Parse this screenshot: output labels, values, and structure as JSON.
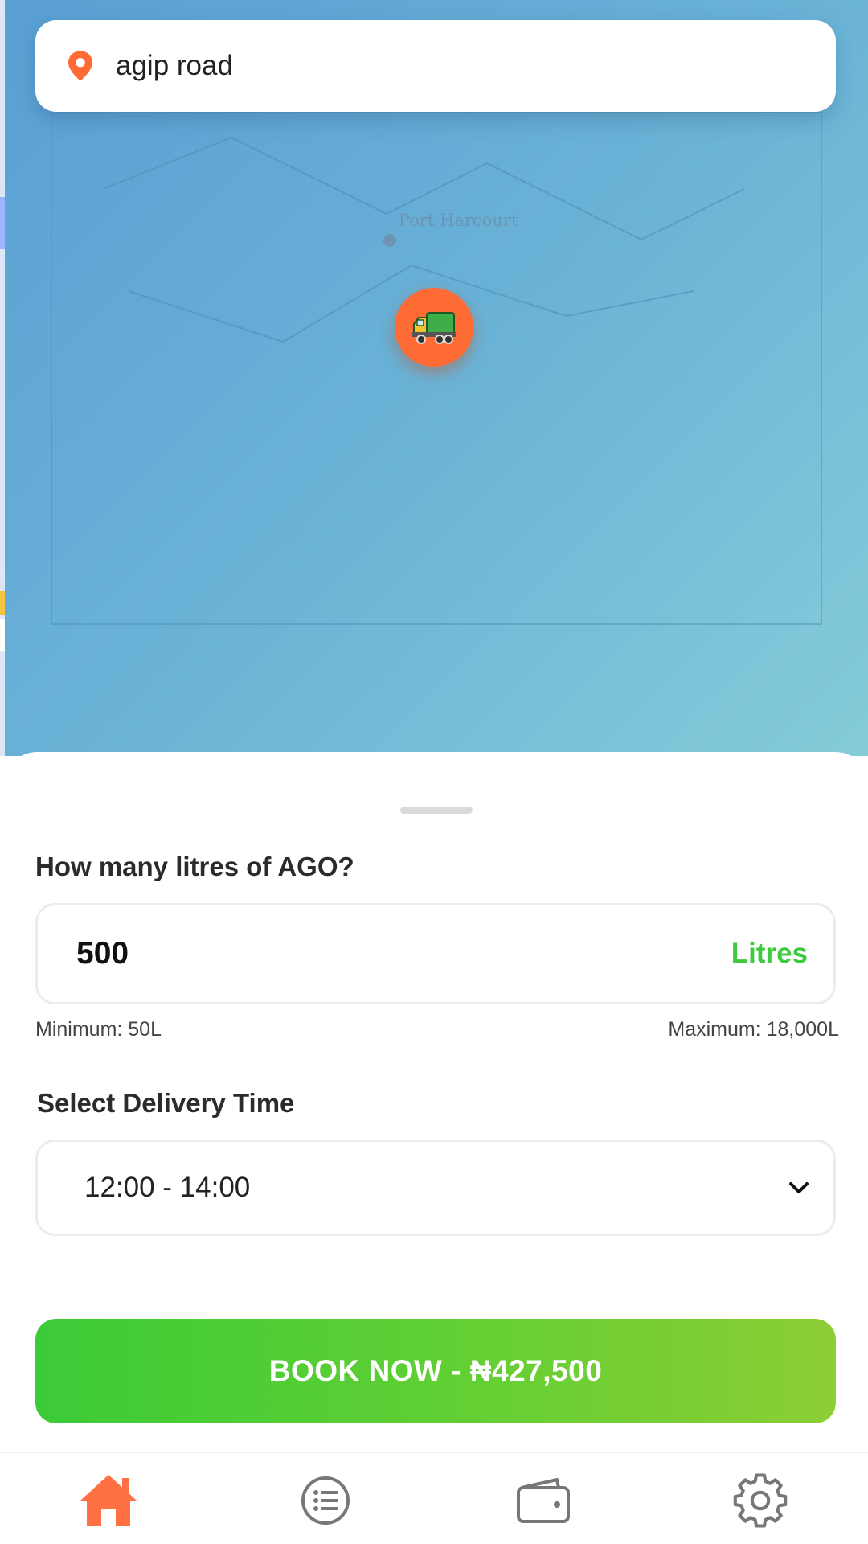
{
  "search": {
    "value": "agip road",
    "icon": "location-pin-icon"
  },
  "map": {
    "city_label": "Port Harcourt",
    "marker_icon": "truck-icon",
    "marker_color": "#ff6b35"
  },
  "order": {
    "litres_question": "How many litres of AGO?",
    "litres_value": "500",
    "litres_unit": "Litres",
    "minimum": "Minimum: 50L",
    "maximum": "Maximum: 18,000L",
    "time_question": "Select Delivery Time",
    "time_value": "12:00 - 14:00"
  },
  "book_button": {
    "label": "BOOK NOW - ₦427,500"
  },
  "nav": {
    "items": [
      {
        "name": "home",
        "icon": "home-icon",
        "active": true
      },
      {
        "name": "orders",
        "icon": "list-icon",
        "active": false
      },
      {
        "name": "wallet",
        "icon": "wallet-icon",
        "active": false
      },
      {
        "name": "settings",
        "icon": "gear-icon",
        "active": false
      }
    ]
  },
  "colors": {
    "accent": "#ff6b35",
    "green": "#3ec93e",
    "button_gradient_start": "#3ccb38",
    "button_gradient_end": "#8dce36"
  }
}
